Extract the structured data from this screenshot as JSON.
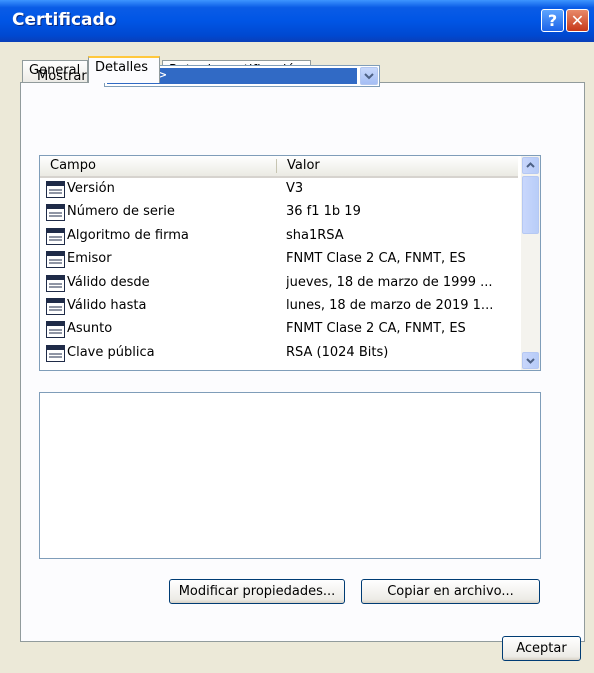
{
  "window": {
    "title": "Certificado",
    "help_label": "?",
    "close_label": "✕"
  },
  "tabs": [
    {
      "label": "General"
    },
    {
      "label": "Detalles"
    },
    {
      "label": "Ruta de certificación"
    }
  ],
  "mostrar": {
    "label": "Mostrar:",
    "value": "<Todos>"
  },
  "list": {
    "columns": {
      "field": "Campo",
      "value": "Valor"
    },
    "rows": [
      {
        "field": "Versión",
        "value": "V3"
      },
      {
        "field": "Número de serie",
        "value": "36 f1 1b 19"
      },
      {
        "field": "Algoritmo de firma",
        "value": "sha1RSA"
      },
      {
        "field": "Emisor",
        "value": "FNMT Clase 2 CA, FNMT, ES"
      },
      {
        "field": "Válido desde",
        "value": "jueves, 18 de marzo de 1999 ..."
      },
      {
        "field": "Válido hasta",
        "value": "lunes, 18 de marzo de 2019 1..."
      },
      {
        "field": "Asunto",
        "value": "FNMT Clase 2 CA, FNMT, ES"
      },
      {
        "field": "Clave pública",
        "value": "RSA (1024 Bits)"
      }
    ]
  },
  "buttons": {
    "edit_properties": "Modificar propiedades...",
    "copy_to_file": "Copiar en archivo...",
    "accept": "Aceptar"
  },
  "colors": {
    "titlebar": "#0055e5",
    "selection": "#316ac5",
    "tab_highlight": "#ffc83c"
  }
}
